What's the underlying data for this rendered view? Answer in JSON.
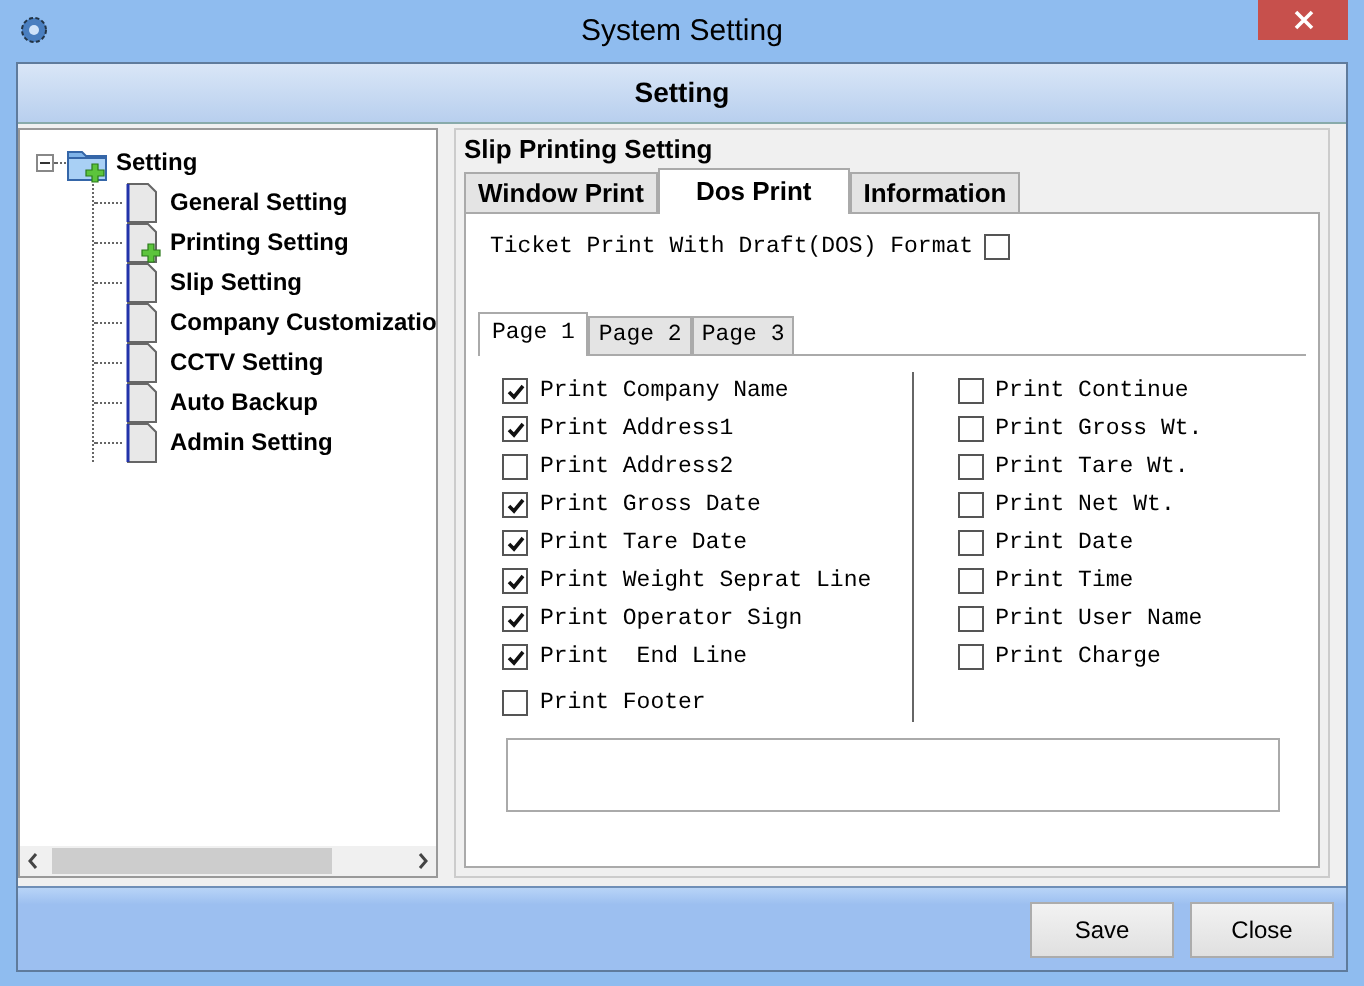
{
  "window": {
    "title": "System Setting"
  },
  "header": {
    "title": "Setting"
  },
  "tree": {
    "label": "Setting",
    "expanded": true,
    "children": [
      {
        "label": "General Setting",
        "kind": "page"
      },
      {
        "label": "Printing Setting",
        "kind": "page_add"
      },
      {
        "label": "Slip Setting",
        "kind": "page"
      },
      {
        "label": "Company Customizatio",
        "kind": "page"
      },
      {
        "label": "CCTV Setting",
        "kind": "page"
      },
      {
        "label": "Auto Backup",
        "kind": "page"
      },
      {
        "label": "Admin Setting",
        "kind": "page"
      }
    ]
  },
  "panel": {
    "title": "Slip Printing Setting",
    "tabs": [
      {
        "label": "Window Print",
        "selected": false
      },
      {
        "label": "Dos Print",
        "selected": true
      },
      {
        "label": "Information",
        "selected": false
      }
    ],
    "draft_option": {
      "label": "Ticket Print With Draft(DOS) Format",
      "checked": false
    },
    "page_tabs": [
      {
        "label": "Page 1",
        "selected": true
      },
      {
        "label": "Page 2",
        "selected": false
      },
      {
        "label": "Page 3",
        "selected": false
      }
    ],
    "left_options": [
      {
        "label": "Print Company Name",
        "checked": true
      },
      {
        "label": "Print Address1",
        "checked": true
      },
      {
        "label": "Print Address2",
        "checked": false
      },
      {
        "label": "Print Gross Date",
        "checked": true
      },
      {
        "label": "Print Tare Date",
        "checked": true
      },
      {
        "label": "Print Weight Seprat Line",
        "checked": true
      },
      {
        "label": "Print Operator Sign",
        "checked": true
      },
      {
        "label": "Print  End Line",
        "checked": true
      },
      {
        "label": "Print Footer",
        "checked": false
      }
    ],
    "right_options": [
      {
        "label": "Print Continue",
        "checked": false
      },
      {
        "label": "Print Gross Wt.",
        "checked": false
      },
      {
        "label": "Print Tare Wt.",
        "checked": false
      },
      {
        "label": "Print Net Wt.",
        "checked": false
      },
      {
        "label": "Print Date",
        "checked": false
      },
      {
        "label": "Print Time",
        "checked": false
      },
      {
        "label": "Print User Name",
        "checked": false
      },
      {
        "label": "Print Charge",
        "checked": false
      }
    ]
  },
  "buttons": [
    "Save",
    "Close"
  ]
}
